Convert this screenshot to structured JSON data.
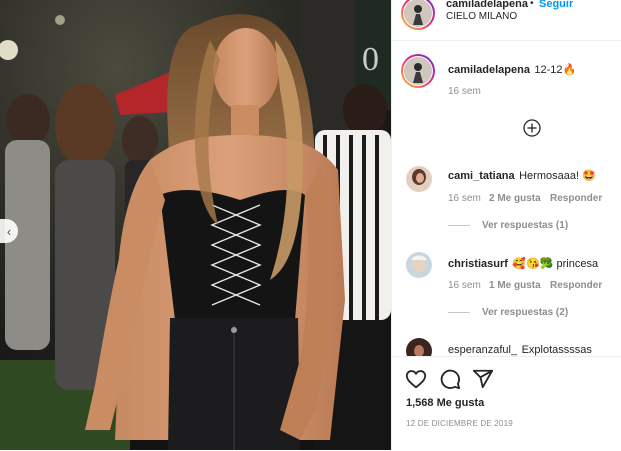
{
  "post": {
    "image_alt": "Mujer con corsé negro en una fiesta",
    "nav_prev_icon": "chevron-left-icon"
  },
  "header": {
    "username": "camiladelapena",
    "separator": "•",
    "follow_label": "Seguir",
    "location": "CIELO MILANO"
  },
  "caption": {
    "username": "camiladelapena",
    "text": "12-12",
    "emoji": "🔥",
    "time": "16 sem"
  },
  "load_more_icon": "plus-circle-icon",
  "comments": [
    {
      "username": "cami_tatiana",
      "text": "Hermosaaa! 🤩",
      "time": "16 sem",
      "likes": "2 Me gusta",
      "reply_label": "Responder",
      "view_replies": "Ver respuestas (1)"
    },
    {
      "username": "christiasurf",
      "text": "🥰😘🥦 princesa",
      "time": "16 sem",
      "likes": "1 Me gusta",
      "reply_label": "Responder",
      "view_replies": "Ver respuestas (2)"
    },
    {
      "username": "esperanzaful_",
      "text": "Explotassssas"
    }
  ],
  "actions": {
    "like_icon": "heart-icon",
    "comment_icon": "comment-icon",
    "share_icon": "send-icon",
    "likes_count": "1,568 Me gusta",
    "date": "12 DE DICIEMBRE DE 2019"
  },
  "colors": {
    "accent": "#0095f6",
    "text": "#262626",
    "muted": "#8e8e8e",
    "border": "#efefef"
  }
}
